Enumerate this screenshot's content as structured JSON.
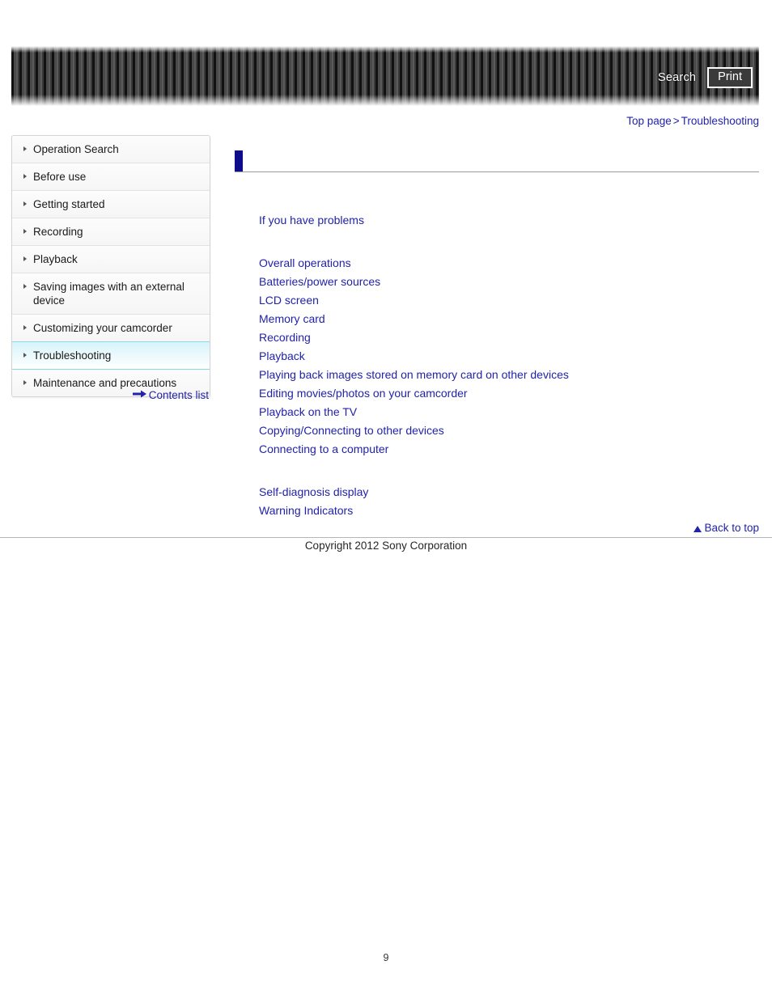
{
  "banner": {
    "search_label": "Search",
    "print_label": "Print"
  },
  "breadcrumb": {
    "top_page": "Top page",
    "separator": ">",
    "current": "Troubleshooting"
  },
  "sidebar": {
    "items": [
      {
        "label": "Operation Search",
        "active": false
      },
      {
        "label": "Before use",
        "active": false
      },
      {
        "label": "Getting started",
        "active": false
      },
      {
        "label": "Recording",
        "active": false
      },
      {
        "label": "Playback",
        "active": false
      },
      {
        "label": "Saving images with an external device",
        "active": false
      },
      {
        "label": "Customizing your camcorder",
        "active": false
      },
      {
        "label": "Troubleshooting",
        "active": true
      },
      {
        "label": "Maintenance and precautions",
        "active": false
      }
    ],
    "contents_list_label": "Contents list"
  },
  "main": {
    "heading": "",
    "intro_link": "If you have problems",
    "topic_links": [
      "Overall operations",
      "Batteries/power sources",
      "LCD screen",
      "Memory card",
      "Recording",
      "Playback",
      "Playing back images stored on memory card on other devices",
      "Editing movies/photos on your camcorder",
      "Playback on the TV",
      "Copying/Connecting to other devices",
      "Connecting to a computer"
    ],
    "diagnostic_links": [
      "Self-diagnosis display",
      "Warning Indicators"
    ]
  },
  "footer": {
    "back_to_top": "Back to top",
    "copyright": "Copyright 2012 Sony Corporation",
    "page_number": "9"
  },
  "colors": {
    "link": "#2222aa",
    "heading_marker": "#0d0d8c",
    "active_nav": "#d6f3fa"
  }
}
